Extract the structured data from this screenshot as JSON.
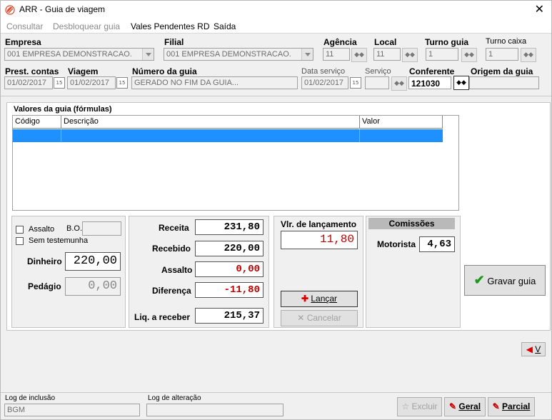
{
  "window": {
    "title": "ARR - Guia de viagem",
    "close": "✕"
  },
  "menu": {
    "consultar": "Consultar",
    "desbloquear": "Desbloquear guia",
    "vales": "Vales Pendentes RD",
    "saida": "Saída"
  },
  "header": {
    "empresa_label": "Empresa",
    "empresa_value": "001 EMPRESA DEMONSTRACAO.",
    "filial_label": "Filial",
    "filial_value": "001 EMPRESA DEMONSTRACAO.",
    "agencia_label": "Agência",
    "agencia_value": "11",
    "local_label": "Local",
    "local_value": "11",
    "turno_guia_label": "Turno guia",
    "turno_guia_value": "1",
    "turno_caixa_label": "Turno caixa",
    "turno_caixa_value": "1",
    "prest_label": "Prest. contas",
    "prest_value": "01/02/2017",
    "viagem_label": "Viagem",
    "viagem_value": "01/02/2017",
    "numero_label": "Número da guia",
    "numero_value": "GERADO NO FIM DA GUIA...",
    "data_servico_label": "Data serviço",
    "data_servico_value": "01/02/2017",
    "servico_label": "Serviço",
    "servico_value": "",
    "conferente_label": "Conferente",
    "conferente_value": "121030",
    "origem_label": "Origem da guia",
    "origem_value": ""
  },
  "grid": {
    "title": "Valores da guia (fórmulas)",
    "col_codigo": "Código",
    "col_descricao": "Descrição",
    "col_valor": "Valor"
  },
  "left": {
    "assalto_label": "Assalto",
    "bo_label": "B.O.",
    "sem_label": "Sem testemunha",
    "dinheiro_label": "Dinheiro",
    "dinheiro_value": "220,00",
    "pedagio_label": "Pedágio",
    "pedagio_value": "0,00"
  },
  "summary": {
    "receita_label": "Receita",
    "receita_value": "231,80",
    "recebido_label": "Recebido",
    "recebido_value": "220,00",
    "assalto_label": "Assalto",
    "assalto_value": "0,00",
    "diferenca_label": "Diferença",
    "diferenca_value": "-11,80",
    "liq_label": "Liq. a receber",
    "liq_value": "215,37"
  },
  "lancamento": {
    "label": "Vlr. de lançamento",
    "value": "11,80",
    "lancar": "Lançar",
    "cancelar": "Cancelar"
  },
  "comissoes": {
    "title": "Comissões",
    "motorista_label": "Motorista",
    "motorista_value": "4,63"
  },
  "actions": {
    "gravar": "Gravar guia",
    "v": "V"
  },
  "status": {
    "inclusao_label": "Log de inclusão",
    "inclusao_value": "BGM",
    "alteracao_label": "Log de alteração",
    "alteracao_value": "",
    "excluir": "Excluir",
    "geral": "Geral",
    "parcial": "Parcial"
  }
}
